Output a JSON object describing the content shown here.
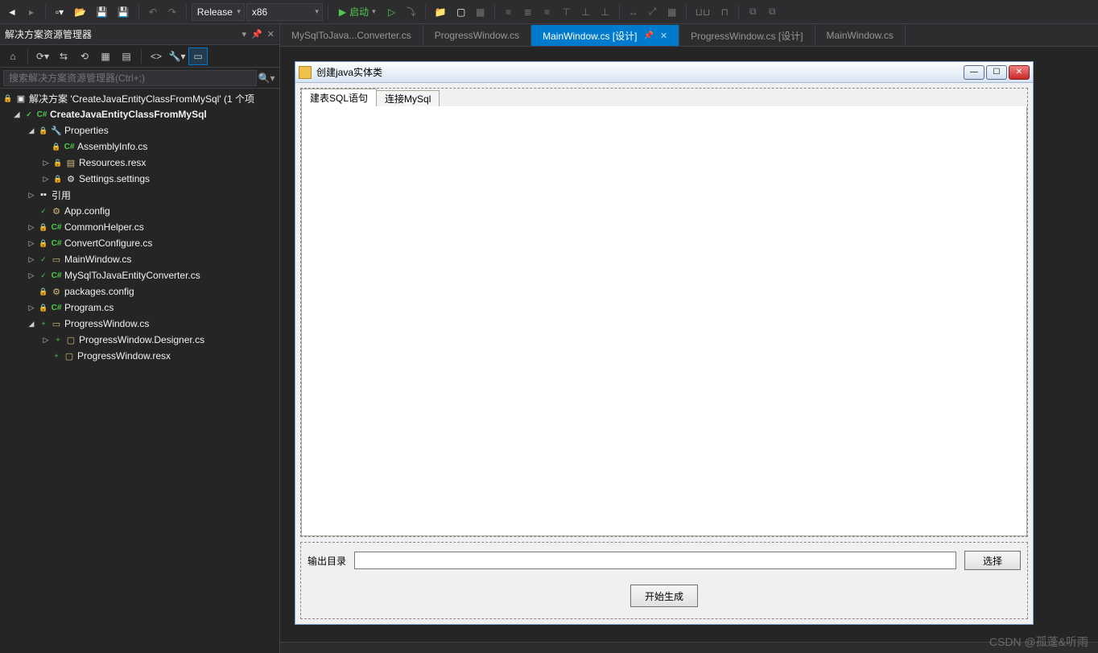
{
  "toolbar": {
    "config": "Release",
    "platform": "x86",
    "start_label": "启动"
  },
  "panel": {
    "title": "解决方案资源管理器",
    "search_placeholder": "搜索解决方案资源管理器(Ctrl+;)",
    "solution_label": "解决方案 'CreateJavaEntityClassFromMySql' (1 个项",
    "project": "CreateJavaEntityClassFromMySql",
    "properties": "Properties",
    "assemblyinfo": "AssemblyInfo.cs",
    "resources": "Resources.resx",
    "settings": "Settings.settings",
    "references": "引用",
    "appconfig": "App.config",
    "commonhelper": "CommonHelper.cs",
    "convertconfigure": "ConvertConfigure.cs",
    "mainwindow": "MainWindow.cs",
    "converter": "MySqlToJavaEntityConverter.cs",
    "packages": "packages.config",
    "program": "Program.cs",
    "progresswindow": "ProgressWindow.cs",
    "progresswindow_designer": "ProgressWindow.Designer.cs",
    "progresswindow_resx": "ProgressWindow.resx"
  },
  "tabs": {
    "t1": "MySqlToJava...Converter.cs",
    "t2": "ProgressWindow.cs",
    "t3": "MainWindow.cs [设计]",
    "t4": "ProgressWindow.cs [设计]",
    "t5": "MainWindow.cs"
  },
  "form": {
    "title": "创建java实体类",
    "tab1": "建表SQL语句",
    "tab2": "连接MySql",
    "output_label": "输出目录",
    "select_btn": "选择",
    "generate_btn": "开始生成"
  },
  "watermark": "CSDN @孤蓬&听雨"
}
